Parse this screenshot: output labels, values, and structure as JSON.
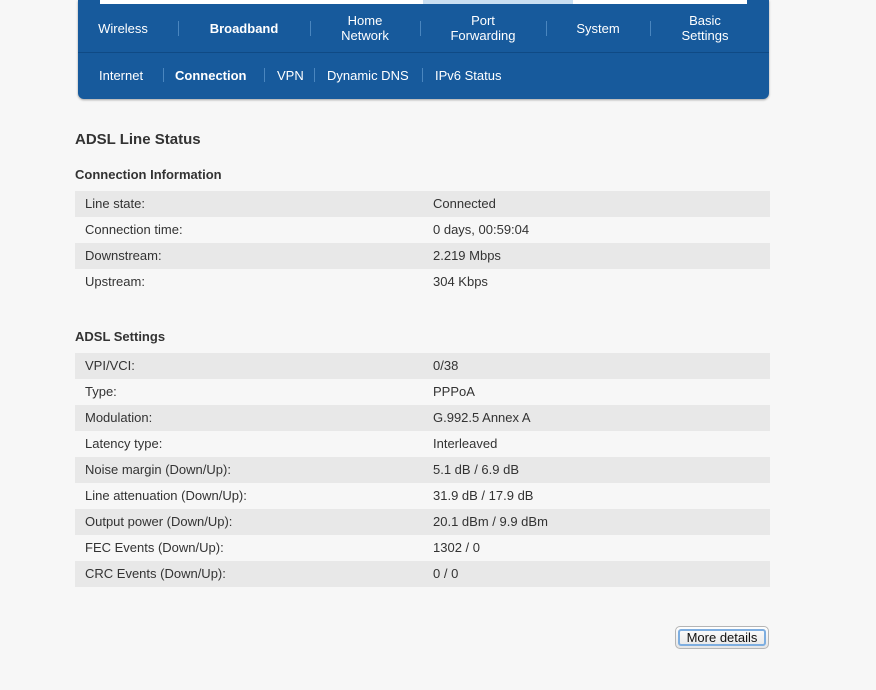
{
  "nav": {
    "tabs": [
      {
        "label": "Wireless"
      },
      {
        "label": "Broadband"
      },
      {
        "label": "Home\nNetwork"
      },
      {
        "label": "Port\nForwarding"
      },
      {
        "label": "System"
      },
      {
        "label": "Basic\nSettings"
      }
    ],
    "subtabs": [
      {
        "label": "Internet"
      },
      {
        "label": "Connection"
      },
      {
        "label": "VPN"
      },
      {
        "label": "Dynamic DNS"
      },
      {
        "label": "IPv6 Status"
      }
    ]
  },
  "page": {
    "title": "ADSL Line Status"
  },
  "connection_info": {
    "title": "Connection Information",
    "rows": [
      {
        "label": "Line state:",
        "value": "Connected"
      },
      {
        "label": "Connection time:",
        "value": "0 days, 00:59:04"
      },
      {
        "label": "Downstream:",
        "value": "2.219 Mbps"
      },
      {
        "label": "Upstream:",
        "value": "304 Kbps"
      }
    ]
  },
  "adsl_settings": {
    "title": "ADSL Settings",
    "rows": [
      {
        "label": "VPI/VCI:",
        "value": "0/38"
      },
      {
        "label": "Type:",
        "value": "PPPoA"
      },
      {
        "label": "Modulation:",
        "value": "G.992.5 Annex A"
      },
      {
        "label": "Latency type:",
        "value": "Interleaved"
      },
      {
        "label": "Noise margin (Down/Up):",
        "value": "5.1 dB / 6.9 dB"
      },
      {
        "label": "Line attenuation (Down/Up):",
        "value": "31.9 dB / 17.9 dB"
      },
      {
        "label": "Output power (Down/Up):",
        "value": "20.1 dBm / 9.9 dBm"
      },
      {
        "label": "FEC Events (Down/Up):",
        "value": "1302 / 0"
      },
      {
        "label": "CRC Events (Down/Up):",
        "value": "0 / 0"
      }
    ]
  },
  "buttons": {
    "more_details": "More details"
  },
  "colors": {
    "nav_background": "#175a9c",
    "row_stripe": "#e8e8e8",
    "page_background": "#f7f7f7"
  }
}
